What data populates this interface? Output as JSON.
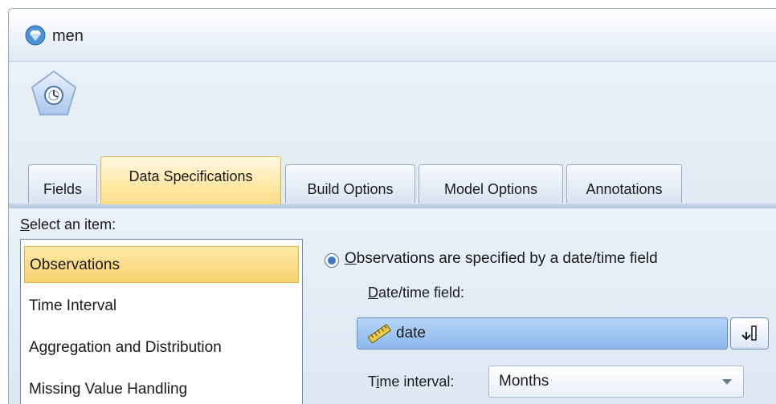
{
  "window": {
    "title": "men"
  },
  "tabs": [
    {
      "label": "Fields",
      "active": false
    },
    {
      "label": "Data Specifications",
      "active": true
    },
    {
      "label": "Build Options",
      "active": false
    },
    {
      "label": "Model Options",
      "active": false
    },
    {
      "label": "Annotations",
      "active": false
    }
  ],
  "item_panel": {
    "label_mnemonic": "S",
    "label_rest": "elect an item:",
    "items": [
      {
        "label": "Observations",
        "selected": true
      },
      {
        "label": "Time Interval",
        "selected": false
      },
      {
        "label": "Aggregation and Distribution",
        "selected": false
      },
      {
        "label": "Missing Value Handling",
        "selected": false
      }
    ]
  },
  "observations": {
    "radio_mnemonic": "O",
    "radio_rest": "bservations are specified by a date/time field",
    "radio_selected": true,
    "datetime_label_mnemonic": "D",
    "datetime_label_rest": "ate/time field:",
    "datetime_field_value": "date",
    "datetime_field_icon": "ruler-icon",
    "time_interval_label_pre": "T",
    "time_interval_label_mnemonic": "i",
    "time_interval_label_post": "me interval:",
    "time_interval_value": "Months"
  },
  "colors": {
    "selected_tab": "#fddc88",
    "selected_item": "#f8d26e",
    "field_highlight": "#a0c6f2"
  }
}
